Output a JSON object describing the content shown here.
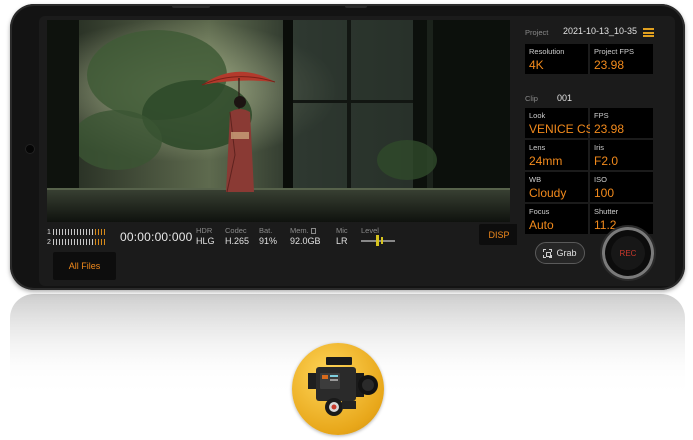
{
  "status_bar": {
    "project_label": "Project",
    "project_value": "2021-10-13_10-35",
    "clip_label": "Clip",
    "clip_value": "001"
  },
  "params": [
    {
      "label": "Resolution",
      "value": "4K"
    },
    {
      "label": "Project FPS",
      "value": "23.98"
    },
    {
      "label": "Look",
      "value": "VENICE CS"
    },
    {
      "label": "FPS",
      "value": "23.98"
    },
    {
      "label": "Lens",
      "value": "24mm"
    },
    {
      "label": "Iris",
      "value": "F2.0"
    },
    {
      "label": "WB",
      "value": "Cloudy"
    },
    {
      "label": "ISO",
      "value": "100"
    },
    {
      "label": "Focus",
      "value": "Auto"
    },
    {
      "label": "Shutter",
      "value": "11.2"
    }
  ],
  "bottom_bar": {
    "meter_ch1": "1",
    "meter_ch2": "2",
    "timecode": "00:00:00:000",
    "hdr_label": "HDR",
    "hdr_value": "HLG",
    "codec_label": "Codec",
    "codec_value": "H.265",
    "battery_label": "Bat.",
    "battery_value": "91%",
    "memory_label": "Mem.",
    "memory_value": "92.0GB",
    "mic_label": "Mic",
    "mic_value": "LR",
    "level_label": "Level"
  },
  "buttons": {
    "disp": "DISP",
    "all_files": "All Files",
    "grab": "Grab",
    "rec": "REC"
  },
  "icons": {
    "menu": "hamburger-menu-icon",
    "grab": "screen-capture-icon",
    "app": "cinema-camera-app-icon"
  },
  "colors": {
    "accent_orange": "#f28a1c",
    "rec_red": "#c8382c",
    "app_icon_gold": "#e8a71a"
  }
}
